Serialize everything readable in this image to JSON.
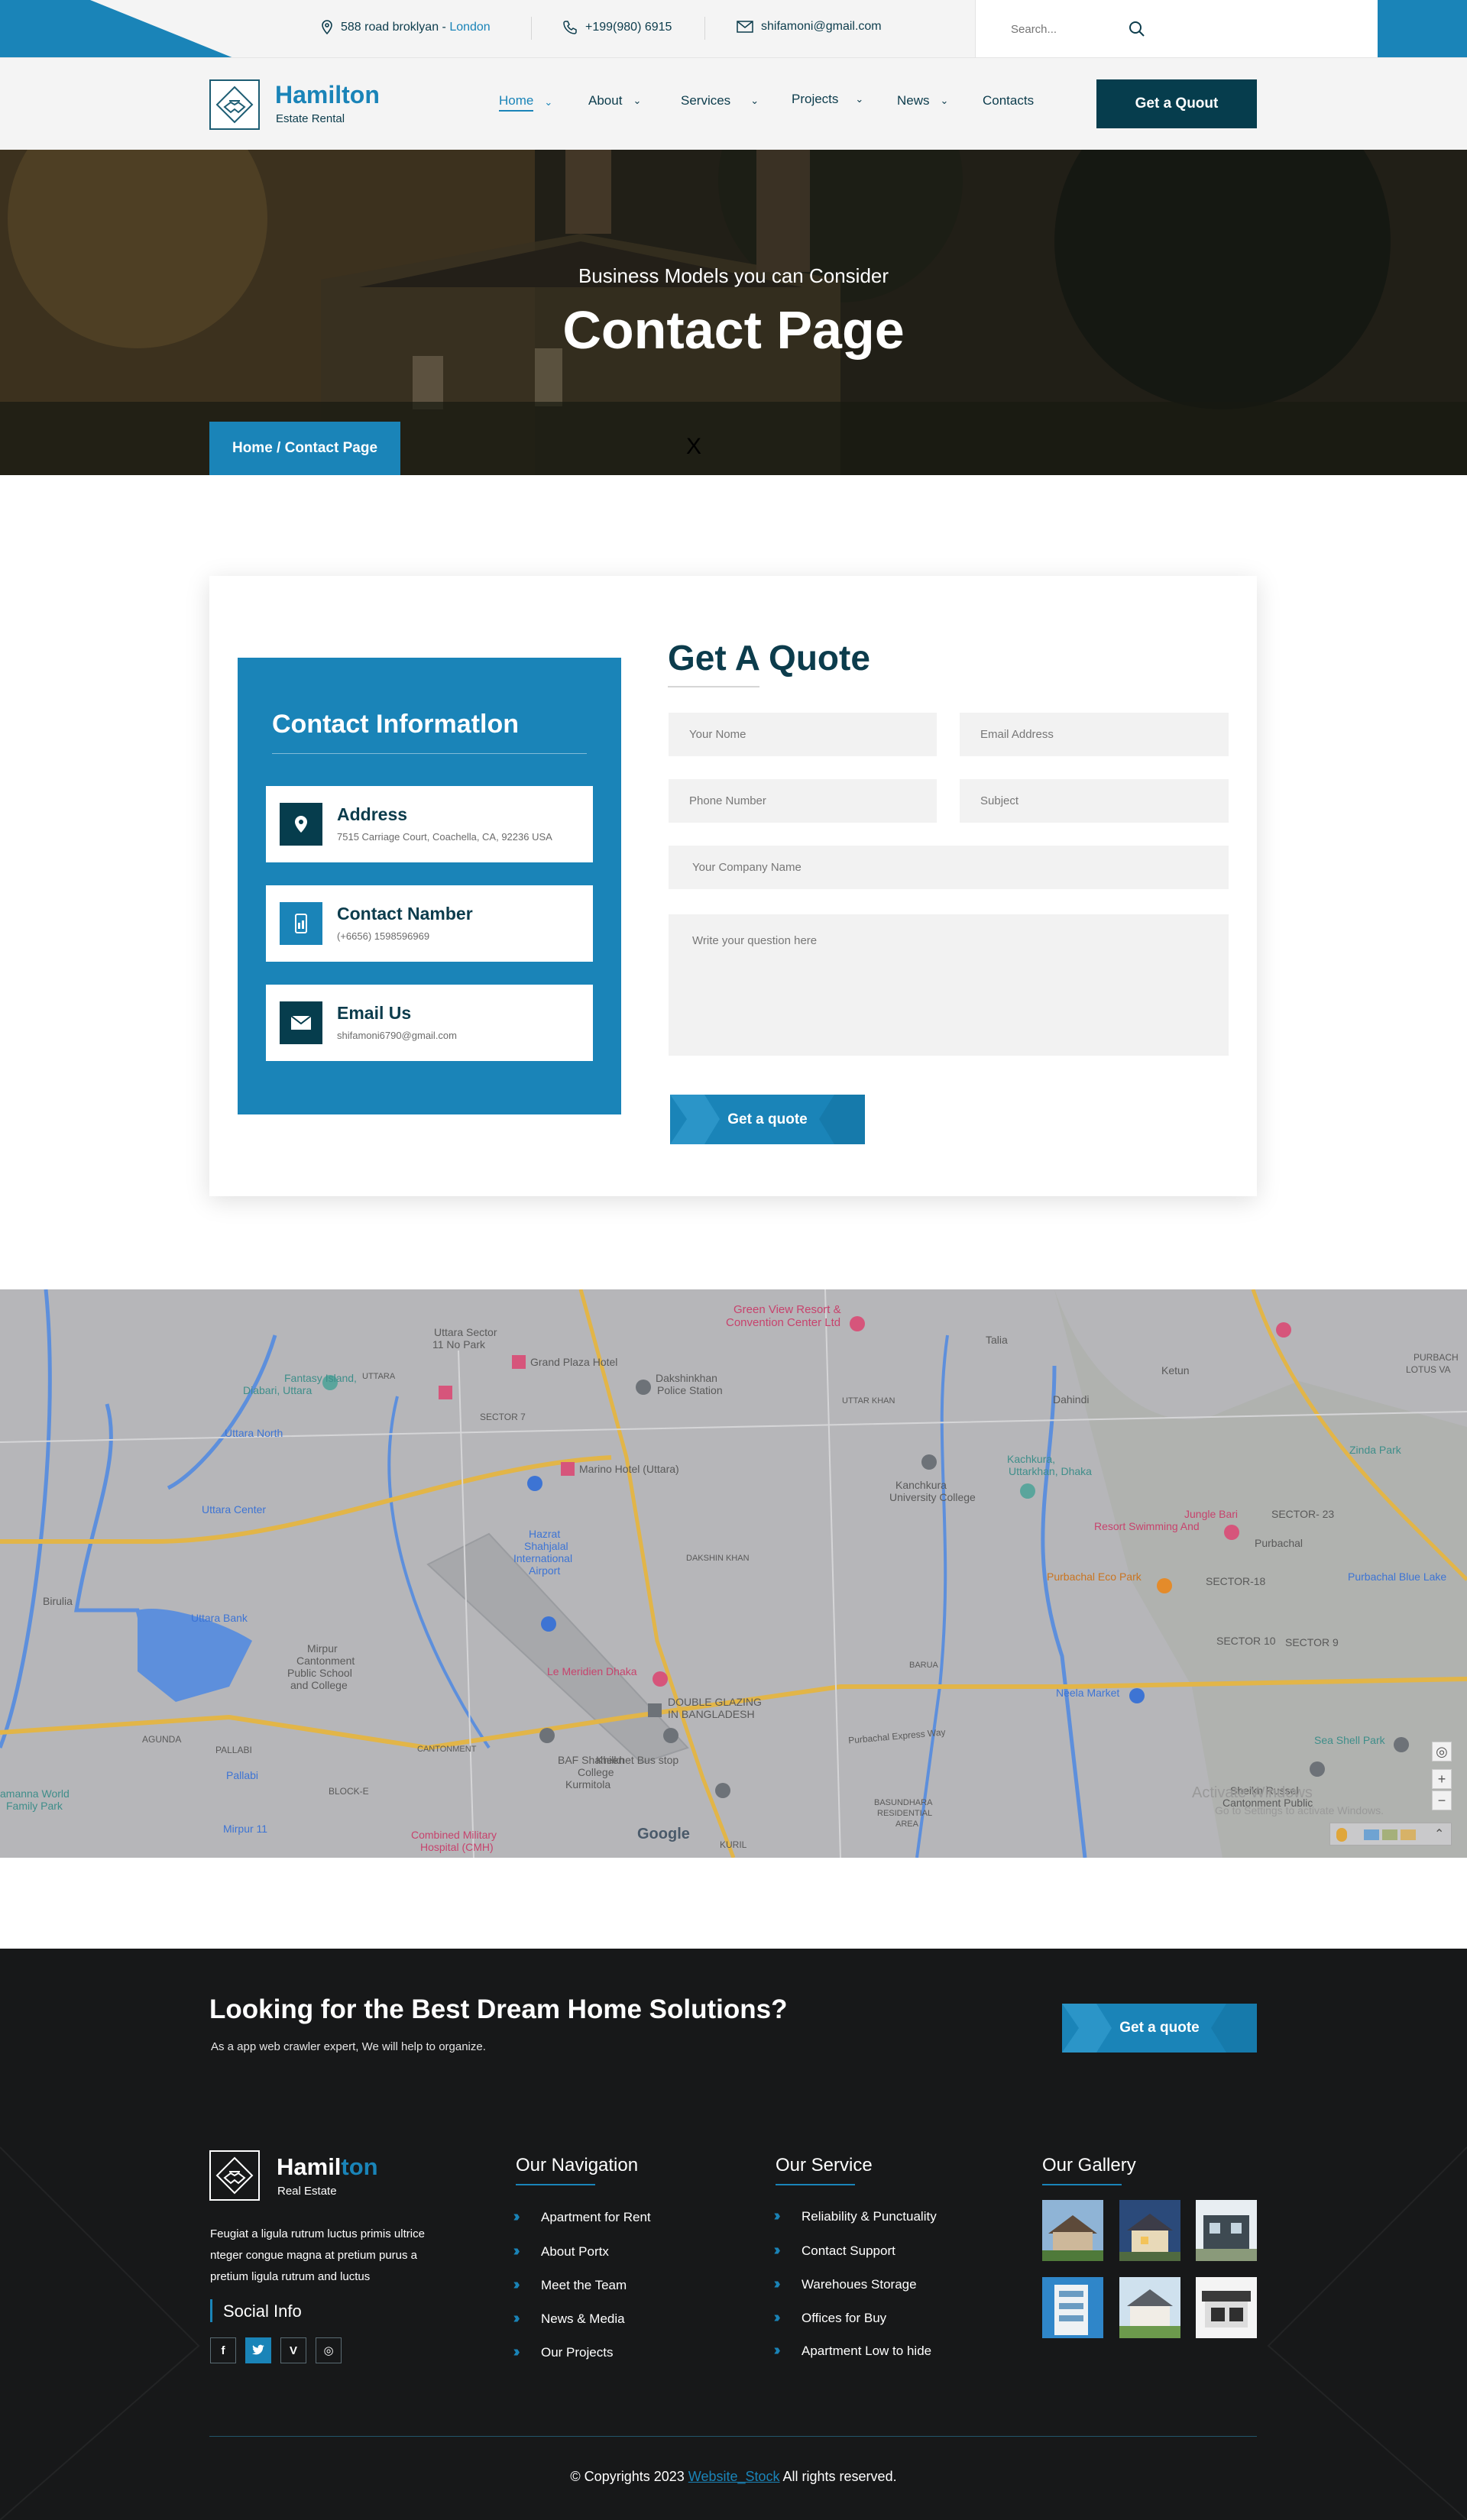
{
  "colors": {
    "accent": "#1a84b8",
    "dark": "#063d4d",
    "footer_bg": "#171819"
  },
  "topbar": {
    "address": "588 road broklyan - ",
    "address_city": "London",
    "phone": "+199(980) 6915",
    "email": "shifamoni@gmail.com",
    "search_placeholder": "Search..."
  },
  "brand": {
    "name": "Hamilton",
    "tagline": "Estate Rental"
  },
  "menu": [
    {
      "label": "Home",
      "icon": "chevron-down-icon"
    },
    {
      "label": "About",
      "icon": "chevron-down-icon"
    },
    {
      "label": "Services",
      "icon": "chevron-down-icon"
    },
    {
      "label": "Projects",
      "icon": "chevron-down-icon"
    },
    {
      "label": "News",
      "icon": "chevron-down-icon"
    },
    {
      "label": "Contacts"
    }
  ],
  "header_cta": "Get a Quout",
  "hero": {
    "subtitle": "Business Models you can Consider",
    "title": "Contact Page",
    "breadcrumb": "Home / Contact Page",
    "mark": "X"
  },
  "contact_info": {
    "title": "Contact Informatlon",
    "items": [
      {
        "heading": "Address",
        "text": "7515 Carriage Court, Coachella, CA, 92236 USA",
        "icon": "map-pin-icon"
      },
      {
        "heading": "Contact Namber",
        "text": "(+6656) 1598596969",
        "icon": "phone-icon"
      },
      {
        "heading": "Email Us",
        "text": "shifamoni6790@gmail.com",
        "icon": "envelope-icon"
      }
    ]
  },
  "quote_form": {
    "title": "Get A Quote",
    "name_placeholder": "Your Nome",
    "email_placeholder": "Email Address",
    "phone_placeholder": "Phone Number",
    "subject_placeholder": "Subject",
    "company_placeholder": "Your Company Name",
    "question_placeholder": "Write your question here",
    "submit_label": "Get a quote"
  },
  "map": {
    "labels": [
      "Green View Resort &",
      "Convention Center Ltd",
      "Talia",
      "Uttara Sector",
      "11 No Park",
      "Grand Plaza Hotel",
      "Dakshinkhan",
      "Police Station",
      "Ketun",
      "Dahindi",
      "Fantasy Island,",
      "Diabari, Uttara",
      "UTTARA",
      "SECTOR 7",
      "UTTAR KHAN",
      "Zinda Park",
      "PURBACH",
      "LOTUS VA",
      "Uttara North",
      "Marino Hotel (Uttara)",
      "Kanchkura",
      "University College",
      "Kachkura,",
      "Uttarkhan, Dhaka",
      "Uttara Center",
      "Hazrat",
      "Shahjalal",
      "International",
      "Airport",
      "DAKSHIN KHAN",
      "Jungle Bari",
      "Resort Swimming And",
      "SECTOR- 23",
      "Purbachal",
      "Birulia",
      "Purbachal Eco Park",
      "SECTOR-18",
      "Purbachal Blue Lake",
      "Uttara Bank",
      "Mirpur",
      "Cantonment",
      "Public School",
      "and College",
      "SECTOR 10",
      "SECTOR 9",
      "Le Meridien Dhaka",
      "BARUA",
      "Neela Market",
      "DOUBLE GLAZING",
      "IN BANGLADESH",
      "AGUNDA",
      "Purbachal Express Way",
      "Sea Shell Park",
      "PALLABI",
      "CANTONMENT",
      "BAF Shaheen",
      "College",
      "Kurmitola",
      "Khilkhet Bus stop",
      "Sheikh Russel",
      "Cantonment Public",
      "amanna World",
      "Family Park",
      "Pallabi",
      "BLOCK-E",
      "Mirpur 11",
      "Combined Military",
      "Hospital (CMH)",
      "BASUNDHARA",
      "RESIDENTIAL",
      "AREA",
      "KURIL",
      "Activate Windows",
      "Go to Settings to activate Windows."
    ],
    "attribution": "Google"
  },
  "footer": {
    "headline": "Looking for the Best Dream Home Solutions?",
    "subline": "As a app web crawler expert, We will help to organize.",
    "cta": "Get a quote",
    "brand_a": "Hamil",
    "brand_b": "ton",
    "brand_tagline": "Real Estate",
    "about": "Feugiat a ligula rutrum luctus primis ultrice nteger congue magna at pretium purus a pretium ligula rutrum and luctus",
    "social_title": "Social Info",
    "social": [
      {
        "name": "facebook-icon",
        "glyph": "f"
      },
      {
        "name": "twitter-icon",
        "glyph": "t"
      },
      {
        "name": "vine-icon",
        "glyph": "V"
      },
      {
        "name": "instagram-icon",
        "glyph": "◎"
      }
    ],
    "nav_title": "Our Navigation",
    "nav_links": [
      "Apartment for Rent",
      "About Portx",
      "Meet the Team",
      "News & Media",
      "Our Projects"
    ],
    "service_title": "Our Service",
    "service_links": [
      "Reliability & Punctuality",
      "Contact Support",
      "Warehoues Storage",
      "Offices for Buy",
      "Apartment Low to hide"
    ],
    "gallery_title": "Our Gallery",
    "copyright_a": "© Copyrights 2023 ",
    "copyright_link": "Website_Stock",
    "copyright_b": " All rights reserved."
  }
}
